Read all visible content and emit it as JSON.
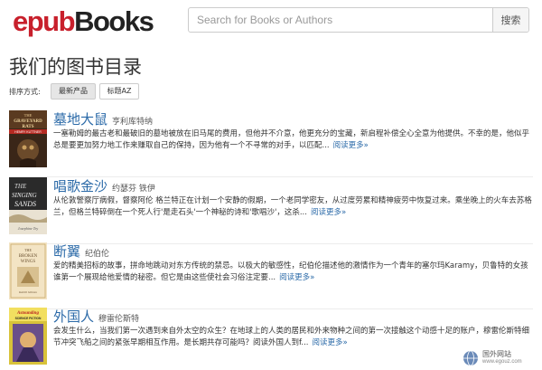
{
  "header": {
    "logo_epub": "epub",
    "logo_books": "Books",
    "search_placeholder": "Search for Books or Authors",
    "search_button": "搜索"
  },
  "page": {
    "title": "我们的图书目录"
  },
  "sort": {
    "label": "排序方式:",
    "options": [
      {
        "label": "最新产品",
        "active": true
      },
      {
        "label": "标题AZ",
        "active": false
      }
    ]
  },
  "books": [
    {
      "title": "墓地大鼠",
      "author": "亨利库特纳",
      "description": "一塞勒姆的最古老和最破旧的墓地被放在旧马尾的费用，但他并不介意，他更充分的宝藏，新启程补偿全心全意为他提供。不幸的是，他似乎总是要更加努力地工作来赚取自己的保持，因为他有一个不寻常的对手，以匹配...",
      "more": "阅读更多»",
      "cover_text": [
        "THE",
        "GRAVEYARD",
        "RATS",
        "HENRY KUTTNER"
      ]
    },
    {
      "title": "唱歌金沙",
      "author": "约瑟芬 铁伊",
      "description": "从伦敦警察厅病假，督察阿伦 格兰特正在计划一个安静的假期，一个老同学密友，从过度劳累和精神疲劳中恢复过来。乘坐晚上的火车去苏格兰，但格兰特碎倒在一个死人行'是走石头'一个神秘的诗和'歌唱沙'，这杀...",
      "more": "阅读更多»",
      "cover_text": [
        "THE",
        "SINGING",
        "SANDS",
        "Josephine Tey"
      ]
    },
    {
      "title": "断翼",
      "author": "纪伯伦",
      "description": "爱的精美招标的故事，拼命地跳动对东方传统的禁忌。以极大的敏感性，纪伯伦描述他的激情作为一个青年的塞尔玛Karamy，贝鲁特的女孩谁第一个展现给他爱情的秘密。但它是由这些使社会习俗注定要...",
      "more": "阅读更多»",
      "cover_text": [
        "THE",
        "BROKEN",
        "WINGS",
        "Kahlil Gibran"
      ]
    },
    {
      "title": "外国人",
      "author": "穆雷伦斯特",
      "description": "会发生什么，当我们第一次遇到来自外太空的众生？在地球上的人类的居民和外来物种之间的第一次接触这个动感十足的账户，穆雷伦斯特细节冲突飞船之间的紧张早期相互作用。是长期共存可能吗？阅读外国人到f...",
      "more": "阅读更多»",
      "cover_text": [
        "Astounding",
        "SCIENCE FICTION"
      ]
    }
  ],
  "watermark": {
    "name": "国外网站",
    "url": "www.egouz.com"
  },
  "colors": {
    "brand_red": "#c8202c",
    "link_blue": "#2b6aa8"
  }
}
